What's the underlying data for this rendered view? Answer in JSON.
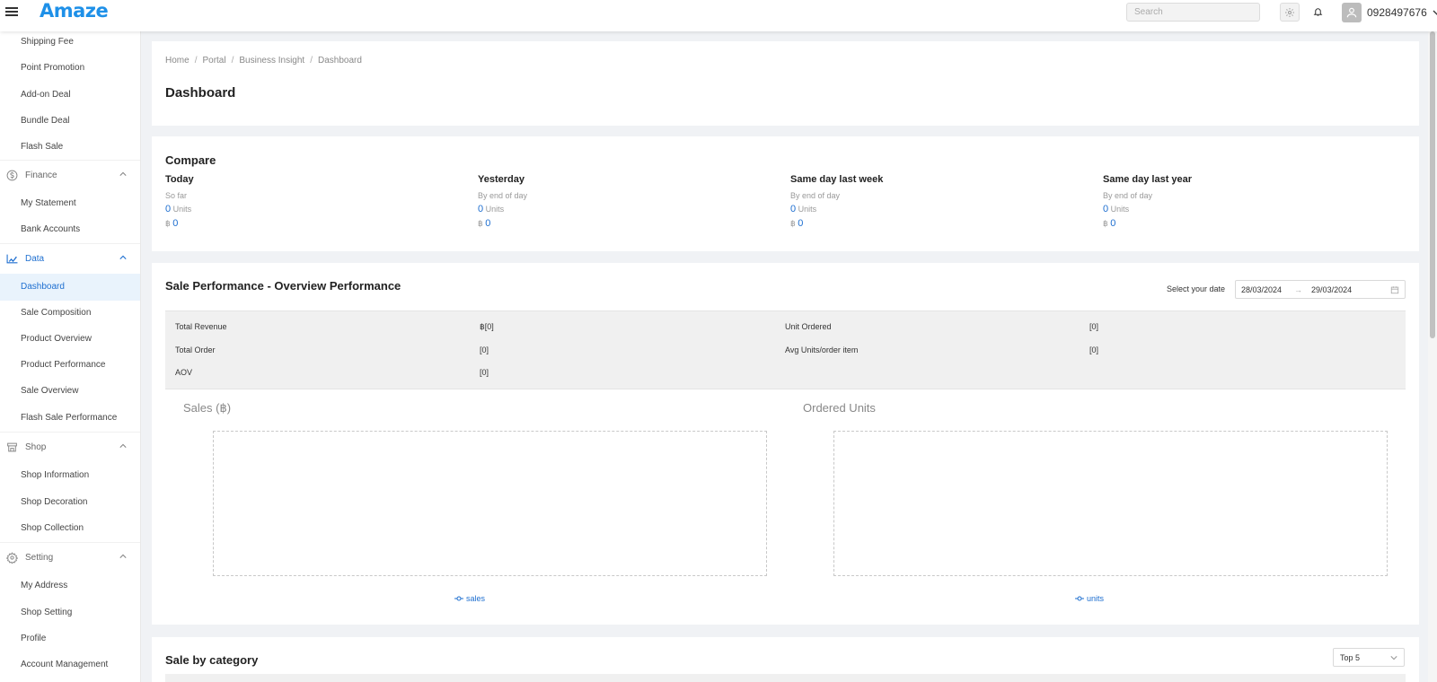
{
  "header": {
    "logo_text": "Amaze",
    "search_placeholder": "Search",
    "username": "0928497676"
  },
  "sidebar": {
    "items_top": [
      "Shipping Fee",
      "Point Promotion",
      "Add-on Deal",
      "Bundle Deal",
      "Flash Sale"
    ],
    "finance": {
      "label": "Finance",
      "items": [
        "My Statement",
        "Bank Accounts"
      ]
    },
    "data": {
      "label": "Data",
      "items": [
        "Dashboard",
        "Sale Composition",
        "Product Overview",
        "Product Performance",
        "Sale Overview",
        "Flash Sale Performance"
      ],
      "active": "Dashboard"
    },
    "shop": {
      "label": "Shop",
      "items": [
        "Shop Information",
        "Shop Decoration",
        "Shop Collection"
      ]
    },
    "setting": {
      "label": "Setting",
      "items": [
        "My Address",
        "Shop Setting",
        "Profile",
        "Account Management"
      ]
    }
  },
  "breadcrumb": [
    "Home",
    "Portal",
    "Business Insight",
    "Dashboard"
  ],
  "page_title": "Dashboard",
  "compare": {
    "title": "Compare",
    "columns": [
      {
        "head": "Today",
        "sub": "So far",
        "units_value": "0",
        "units_label": "Units",
        "currency": "฿",
        "amount": "0"
      },
      {
        "head": "Yesterday",
        "sub": "By end of day",
        "units_value": "0",
        "units_label": "Units",
        "currency": "฿",
        "amount": "0"
      },
      {
        "head": "Same day last week",
        "sub": "By end of day",
        "units_value": "0",
        "units_label": "Units",
        "currency": "฿",
        "amount": "0"
      },
      {
        "head": "Same day last year",
        "sub": "By end of day",
        "units_value": "0",
        "units_label": "Units",
        "currency": "฿",
        "amount": "0"
      }
    ]
  },
  "sale_performance": {
    "title": "Sale Performance - Overview Performance",
    "date_label": "Select your date",
    "date_from": "28/03/2024",
    "date_to": "29/03/2024",
    "metrics": [
      {
        "label": "Total Revenue",
        "value": "฿[0]"
      },
      {
        "label": "Unit Ordered",
        "value": "[0]"
      },
      {
        "label": "Total Order",
        "value": "[0]"
      },
      {
        "label": "Avg Units/order item",
        "value": "[0]"
      },
      {
        "label": "AOV",
        "value": "[0]"
      }
    ],
    "charts": [
      {
        "title": "Sales (฿)",
        "legend": "sales"
      },
      {
        "title": "Ordered Units",
        "legend": "units"
      }
    ]
  },
  "sale_by_category": {
    "title": "Sale by category",
    "select_value": "Top 5"
  },
  "colors": {
    "accent": "#1e6fd0",
    "logo": "#1e90e8",
    "active_bg": "#e9f3fc"
  }
}
